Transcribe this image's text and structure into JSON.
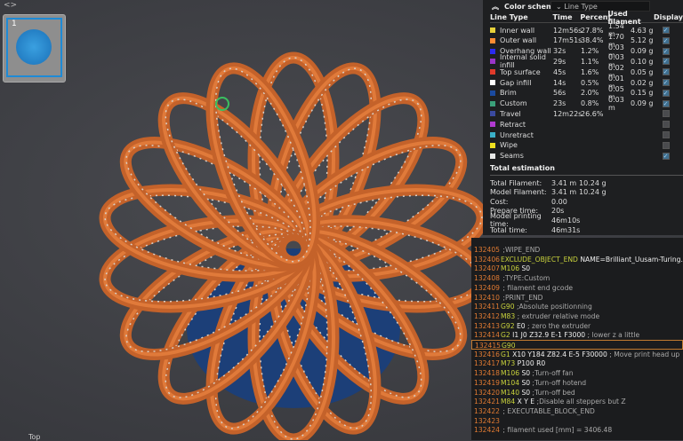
{
  "viewport": {
    "toggle_icon": "chevrons",
    "plate_number": "1",
    "view_label": "Top"
  },
  "legend": {
    "title": "Color scheme",
    "scheme": "Line Type",
    "headers": [
      "Line Type",
      "Time",
      "Percent",
      "Used filament",
      "Display"
    ],
    "rows": [
      {
        "name": "Inner wall",
        "color": "#e8d23a",
        "time": "12m56s",
        "pct": "27.8%",
        "len": "1.54 m",
        "wt": "4.63 g",
        "on": true
      },
      {
        "name": "Outer wall",
        "color": "#ff8c33",
        "time": "17m51s",
        "pct": "38.4%",
        "len": "1.70 m",
        "wt": "5.12 g",
        "on": true
      },
      {
        "name": "Overhang wall",
        "color": "#2a2af0",
        "time": "32s",
        "pct": "1.2%",
        "len": "0.03 m",
        "wt": "0.09 g",
        "on": true
      },
      {
        "name": "Internal solid infill",
        "color": "#9a35c8",
        "time": "29s",
        "pct": "1.1%",
        "len": "0.03 m",
        "wt": "0.10 g",
        "on": true
      },
      {
        "name": "Top surface",
        "color": "#e03a2a",
        "time": "45s",
        "pct": "1.6%",
        "len": "0.02 m",
        "wt": "0.05 g",
        "on": true
      },
      {
        "name": "Gap infill",
        "color": "#ffffff",
        "time": "14s",
        "pct": "0.5%",
        "len": "0.01 m",
        "wt": "0.02 g",
        "on": true
      },
      {
        "name": "Brim",
        "color": "#1a4aa0",
        "time": "56s",
        "pct": "2.0%",
        "len": "0.05 m",
        "wt": "0.15 g",
        "on": true
      },
      {
        "name": "Custom",
        "color": "#3aa07a",
        "time": "23s",
        "pct": "0.8%",
        "len": "0.03 m",
        "wt": "0.09 g",
        "on": true
      },
      {
        "name": "Travel",
        "color": "#3a4aa0",
        "time": "12m22s",
        "pct": "26.6%",
        "len": "",
        "wt": "",
        "on": false
      },
      {
        "name": "Retract",
        "color": "#b03ad0",
        "time": "",
        "pct": "",
        "len": "",
        "wt": "",
        "on": false
      },
      {
        "name": "Unretract",
        "color": "#3ab0c8",
        "time": "",
        "pct": "",
        "len": "",
        "wt": "",
        "on": false
      },
      {
        "name": "Wipe",
        "color": "#f0e020",
        "time": "",
        "pct": "",
        "len": "",
        "wt": "",
        "on": false
      },
      {
        "name": "Seams",
        "color": "#e8e8e8",
        "time": "",
        "pct": "",
        "len": "",
        "wt": "",
        "on": true
      }
    ],
    "total_title": "Total estimation",
    "totals": [
      {
        "k": "Total Filament:",
        "v1": "3.41 m",
        "v2": "10.24 g"
      },
      {
        "k": "Model Filament:",
        "v1": "3.41 m",
        "v2": "10.24 g"
      },
      {
        "k": "Cost:",
        "v1": "0.00",
        "v2": ""
      },
      {
        "k": "Prepare time:",
        "v1": "20s",
        "v2": ""
      },
      {
        "k": "Model printing time:",
        "v1": "46m10s",
        "v2": ""
      },
      {
        "k": "Total time:",
        "v1": "46m31s",
        "v2": ""
      }
    ]
  },
  "gcode": {
    "selected": "132415",
    "lines": [
      {
        "n": "132405",
        "c": "",
        "p": "",
        "m": ";WIPE_END"
      },
      {
        "n": "132406",
        "c": "EXCLUDE_OBJECT_END",
        "p": "NAME=Brilliant_Uusam-Turing.stl_i...",
        "m": ""
      },
      {
        "n": "132407",
        "c": "M106",
        "p": "S0",
        "m": ""
      },
      {
        "n": "132408",
        "c": "",
        "p": "",
        "m": ";TYPE:Custom"
      },
      {
        "n": "132409",
        "c": "",
        "p": "",
        "m": "; filament end gcode"
      },
      {
        "n": "132410",
        "c": "",
        "p": "",
        "m": ";PRINT_END"
      },
      {
        "n": "132411",
        "c": "G90",
        "p": "",
        "m": ";Absolute positionning"
      },
      {
        "n": "132412",
        "c": "M83",
        "p": "",
        "m": "; extruder relative mode"
      },
      {
        "n": "132413",
        "c": "G92",
        "p": "E0",
        "m": "; zero the extruder"
      },
      {
        "n": "132414",
        "c": "G2",
        "p": "I1 J0 Z32.9 E-1 F3000",
        "m": "; lower z a little"
      },
      {
        "n": "132415",
        "c": "G90",
        "p": "",
        "m": ""
      },
      {
        "n": "132416",
        "c": "G1",
        "p": "X10 Y184 Z82.4 E-5 F30000",
        "m": "; Move print head up"
      },
      {
        "n": "132417",
        "c": "M73",
        "p": "P100 R0",
        "m": ""
      },
      {
        "n": "132418",
        "c": "M106",
        "p": "S0",
        "m": ";Turn-off fan"
      },
      {
        "n": "132419",
        "c": "M104",
        "p": "S0",
        "m": ";Turn-off hotend"
      },
      {
        "n": "132420",
        "c": "M140",
        "p": "S0",
        "m": ";Turn-off bed"
      },
      {
        "n": "132421",
        "c": "M84",
        "p": "X Y E",
        "m": ";Disable all steppers but Z"
      },
      {
        "n": "132422",
        "c": "",
        "p": "",
        "m": "; EXECUTABLE_BLOCK_END"
      },
      {
        "n": "132423",
        "c": "",
        "p": "",
        "m": ""
      },
      {
        "n": "132424",
        "c": "",
        "p": "",
        "m": "; filament used [mm] = 3406.48"
      }
    ]
  }
}
